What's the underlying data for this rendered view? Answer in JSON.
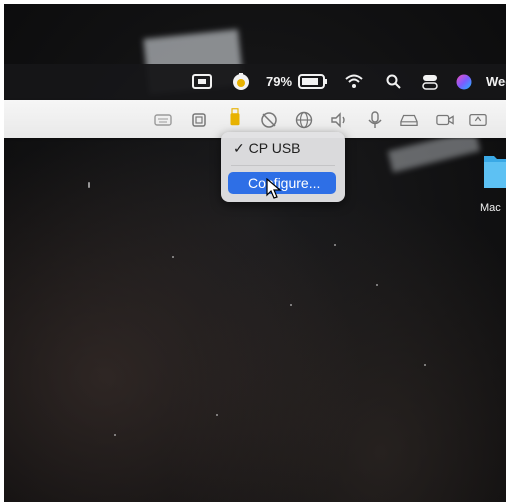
{
  "menubar": {
    "battery_percent": "79%",
    "date_partial": "Wed"
  },
  "usb_menu": {
    "device_label": "CP USB",
    "device_checked": true,
    "configure_label": "Configure..."
  },
  "desktop": {
    "folder_label_partial": "Mac"
  },
  "icons": [
    "screen-mirroring-icon",
    "shield-icon",
    "battery-icon",
    "wifi-icon",
    "search-icon",
    "control-center-icon",
    "siri-icon",
    "keyboard-icon",
    "chip-icon",
    "usb-icon",
    "location-off-icon",
    "globe-icon",
    "speaker-icon",
    "microphone-icon",
    "drive-icon",
    "camera-icon",
    "share-icon",
    "folder-icon"
  ],
  "colors": {
    "selection_blue": "#2e6fe6",
    "toolbar_bg": "#efefef",
    "usb_icon_yellow": "#e8b200",
    "desktop_dark": "#141415"
  }
}
